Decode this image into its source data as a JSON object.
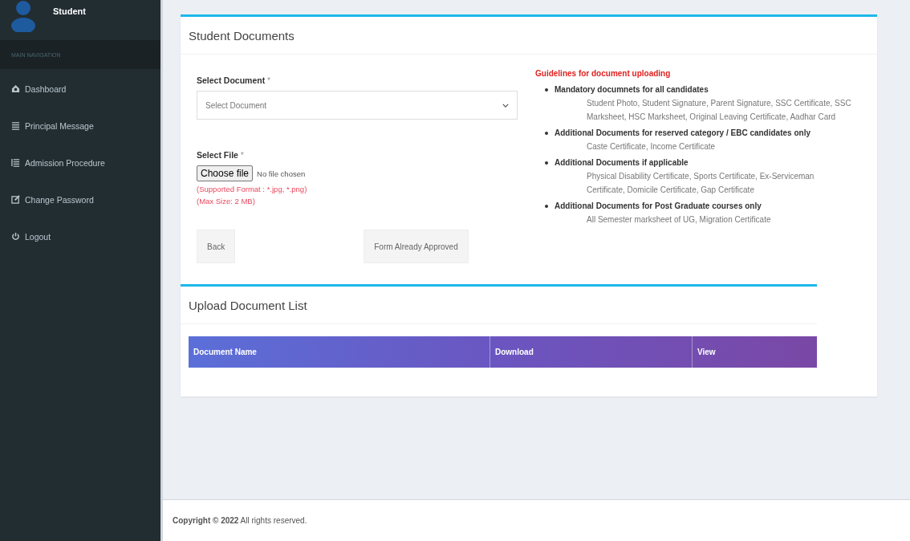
{
  "sidebar": {
    "user": "Student",
    "header": "MAIN NAVIGATION",
    "items": [
      {
        "label": "Dashboard"
      },
      {
        "label": "Principal Message"
      },
      {
        "label": "Admission Procedure"
      },
      {
        "label": "Change Password"
      },
      {
        "label": "Logout"
      }
    ]
  },
  "documents": {
    "title": "Student Documents",
    "select_label": "Select Document",
    "select_placeholder": "Select Document",
    "file_label": "Select File",
    "required_mark": "*",
    "file_button": "Choose file",
    "file_status": "No file chosen",
    "hints": [
      "(Supported Format : *.jpg, *.png)",
      "(Max Size: 2 MB)"
    ],
    "buttons": [
      {
        "label": "Back"
      },
      {
        "label": "Form Already Approved"
      }
    ],
    "guidelines_title": "Guidelines for document uploading",
    "guidelines": [
      {
        "heading": "Mandatory documnets for all candidates",
        "text": "Student Photo, Student Signature, Parent Signature, SSC Certificate, SSC Marksheet, HSC Marksheet, Original Leaving Certificate, Aadhar Card"
      },
      {
        "heading": "Additional Documents for reserved category / EBC candidates only",
        "text": "Caste Certificate, Income Certificate"
      },
      {
        "heading": "Additional Documents if applicable",
        "text": "Physical Disability Certificate, Sports Certificate, Ex-Serviceman Certificate, Domicile Certificate, Gap Certificate"
      },
      {
        "heading": "Additional Documents for Post Graduate courses only",
        "text": "All Semester marksheet of UG, Migration Certificate"
      }
    ]
  },
  "upload_list": {
    "title": "Upload Document List",
    "columns": [
      "Document Name",
      "Download",
      "View"
    ]
  },
  "footer": "**Copyright © 2022** All rights reserved."
}
